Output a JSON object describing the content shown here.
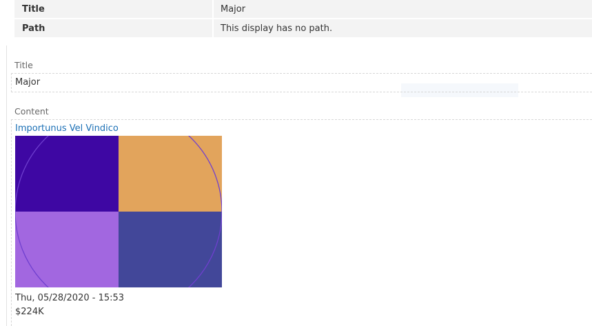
{
  "info": {
    "rows": [
      {
        "key": "Title",
        "value": "Major"
      },
      {
        "key": "Path",
        "value": "This display has no path."
      }
    ]
  },
  "fields": {
    "title": {
      "label": "Title",
      "value": "Major"
    },
    "content": {
      "label": "Content",
      "link_text": "Importunus Vel Vindico",
      "date": "Thu, 05/28/2020 - 15:53",
      "price": "$224K"
    }
  },
  "image": {
    "colors": {
      "top_left": "#3e07a3",
      "top_right": "#e2a45c",
      "bottom_left": "#a267e0",
      "bottom_right": "#424799",
      "arc": "#6f3fcf"
    }
  },
  "colors": {
    "link": "#1a6fb5",
    "table_bg": "#f3f3f3",
    "label": "#666666"
  }
}
